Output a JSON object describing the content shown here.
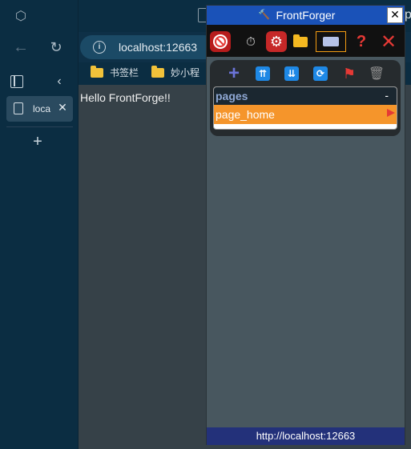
{
  "browser": {
    "url": "localhost:12663",
    "active_tab": {
      "label": "loca",
      "close": "✕"
    },
    "new_tab_symbol": "+",
    "overflow_letter": "p",
    "bookmarks": [
      {
        "label": "书签栏"
      },
      {
        "label": "妙小程"
      }
    ]
  },
  "page": {
    "text": "Hello FrontForge!!"
  },
  "frontforger": {
    "title": "FrontForger",
    "close": "✕",
    "toolbar": {
      "help": "?",
      "exit": "✕"
    },
    "pages_panel": {
      "header": "pages",
      "header_toggle": "-",
      "items": [
        {
          "label": "page_home"
        }
      ]
    },
    "status_url": "http://localhost:12663"
  },
  "colors": {
    "titlebar": "#1a52b8",
    "selected_item": "#f5952b",
    "statusbar": "#23317a"
  }
}
